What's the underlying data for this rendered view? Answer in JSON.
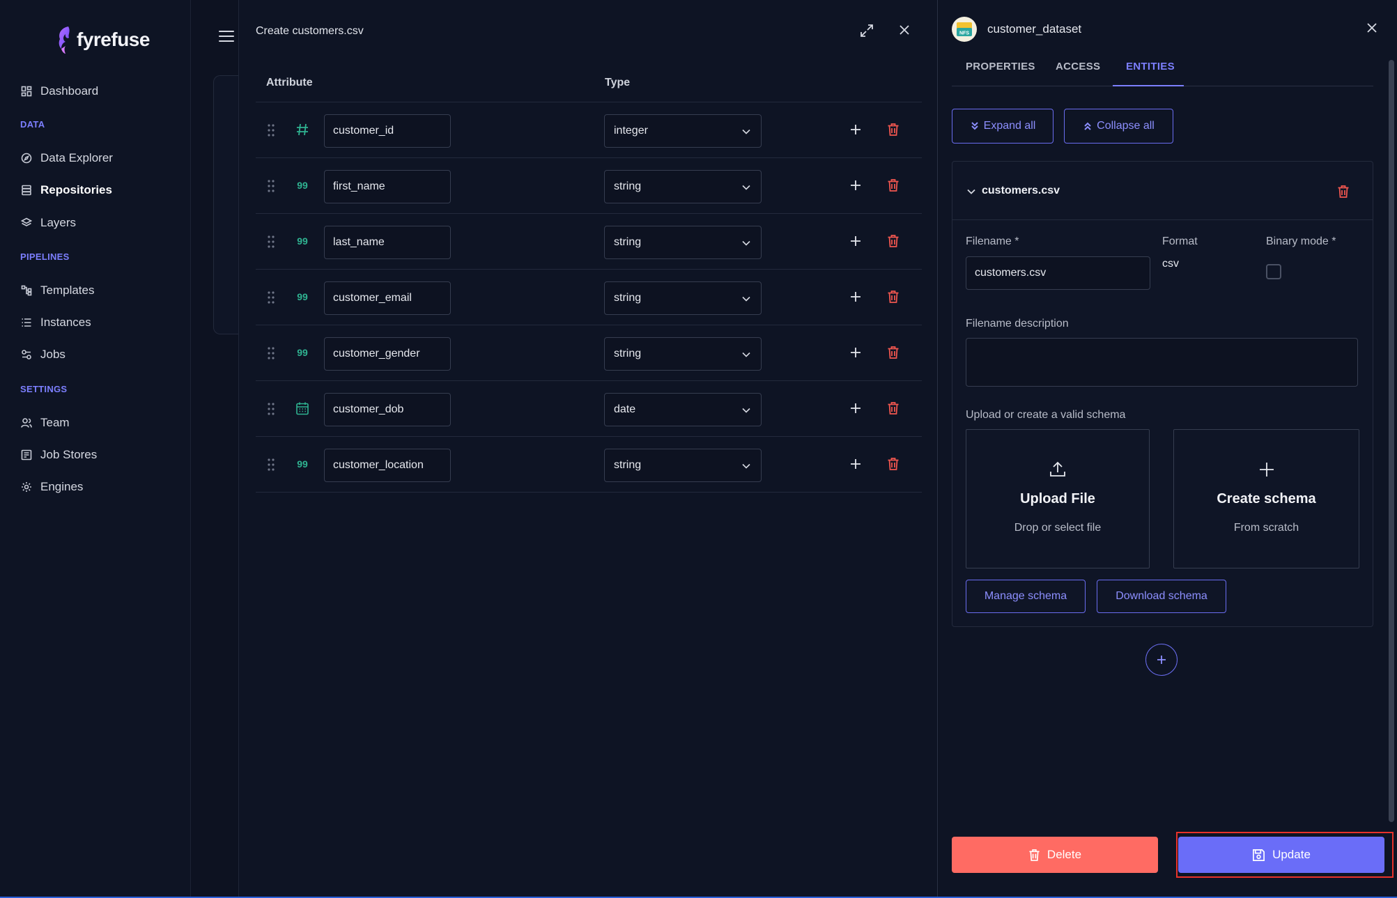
{
  "brand": {
    "name": "fyrefuse"
  },
  "sidebar": {
    "items": [
      {
        "label": "Dashboard",
        "icon": "dashboard-icon"
      },
      {
        "label": "Data Explorer",
        "icon": "compass-icon"
      },
      {
        "label": "Repositories",
        "icon": "database-icon"
      },
      {
        "label": "Layers",
        "icon": "layers-icon"
      },
      {
        "label": "Templates",
        "icon": "templates-icon"
      },
      {
        "label": "Instances",
        "icon": "list-icon"
      },
      {
        "label": "Jobs",
        "icon": "jobs-icon"
      },
      {
        "label": "Team",
        "icon": "team-icon"
      },
      {
        "label": "Job Stores",
        "icon": "job-stores-icon"
      },
      {
        "label": "Engines",
        "icon": "gear-icon"
      }
    ],
    "sections": {
      "data": "DATA",
      "pipelines": "PIPELINES",
      "settings": "SETTINGS"
    },
    "active": "Repositories"
  },
  "modal": {
    "title": "Create customers.csv",
    "columns": {
      "attribute": "Attribute",
      "type": "Type"
    },
    "rows": [
      {
        "attribute": "customer_id",
        "type": "integer",
        "icon": "hash-icon"
      },
      {
        "attribute": "first_name",
        "type": "string",
        "icon": "quote-icon"
      },
      {
        "attribute": "last_name",
        "type": "string",
        "icon": "quote-icon"
      },
      {
        "attribute": "customer_email",
        "type": "string",
        "icon": "quote-icon"
      },
      {
        "attribute": "customer_gender",
        "type": "string",
        "icon": "quote-icon"
      },
      {
        "attribute": "customer_dob",
        "type": "date",
        "icon": "calendar-icon"
      },
      {
        "attribute": "customer_location",
        "type": "string",
        "icon": "quote-icon"
      }
    ]
  },
  "panel": {
    "title": "customer_dataset",
    "logo_text": "NFS",
    "tabs": [
      "PROPERTIES",
      "ACCESS",
      "ENTITIES"
    ],
    "active_tab": "ENTITIES",
    "expand_all": "Expand all",
    "collapse_all": "Collapse all",
    "entity": {
      "name": "customers.csv",
      "filename_label": "Filename *",
      "filename_value": "customers.csv",
      "format_label": "Format",
      "format_value": "csv",
      "binary_label": "Binary mode *",
      "binary_checked": false,
      "description_label": "Filename description",
      "description_value": "",
      "schema_label": "Upload or create a valid schema",
      "upload_title": "Upload File",
      "upload_sub": "Drop or select file",
      "create_title": "Create schema",
      "create_sub": "From scratch",
      "manage_schema": "Manage schema",
      "download_schema": "Download schema"
    },
    "delete_label": "Delete",
    "update_label": "Update"
  },
  "colors": {
    "accent": "#7c7fff",
    "danger": "#ff6b63",
    "type_icon": "#2fb391",
    "highlight": "#e8322b"
  }
}
